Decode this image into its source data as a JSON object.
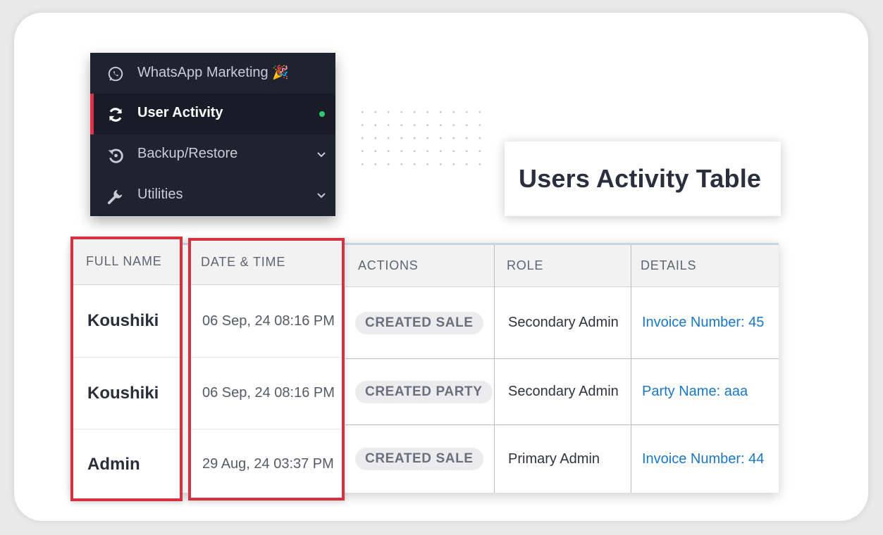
{
  "sidebar": {
    "items": [
      {
        "label": "WhatsApp Marketing",
        "icon": "whatsapp-icon",
        "emoji": "🎉",
        "active": false
      },
      {
        "label": "User Activity",
        "icon": "refresh-icon",
        "active": true
      },
      {
        "label": "Backup/Restore",
        "icon": "restore-icon",
        "active": false,
        "expandable": true
      },
      {
        "label": "Utilities",
        "icon": "wrench-icon",
        "active": false,
        "expandable": true
      }
    ],
    "colors": {
      "background": "#1f2330",
      "active_bar": "#e0304a",
      "status_dot": "#2ecc71"
    }
  },
  "title": "Users Activity Table",
  "table": {
    "columns": [
      "FULL NAME",
      "DATE & TIME",
      "ACTIONS",
      "ROLE",
      "DETAILS"
    ],
    "rows": [
      {
        "full_name": "Koushiki",
        "date_time": "06 Sep, 24 08:16 PM",
        "action": "CREATED SALE",
        "role": "Secondary Admin",
        "details": "Invoice Number: 45"
      },
      {
        "full_name": "Koushiki",
        "date_time": "06 Sep, 24 08:16 PM",
        "action": "CREATED PARTY",
        "role": "Secondary Admin",
        "details": "Party Name: aaa"
      },
      {
        "full_name": "Admin",
        "date_time": "29 Aug, 24 03:37 PM",
        "action": "CREATED SALE",
        "role": "Primary Admin",
        "details": "Invoice Number: 44"
      }
    ]
  },
  "colors": {
    "highlight": "#d7313f",
    "link": "#1877c9"
  }
}
